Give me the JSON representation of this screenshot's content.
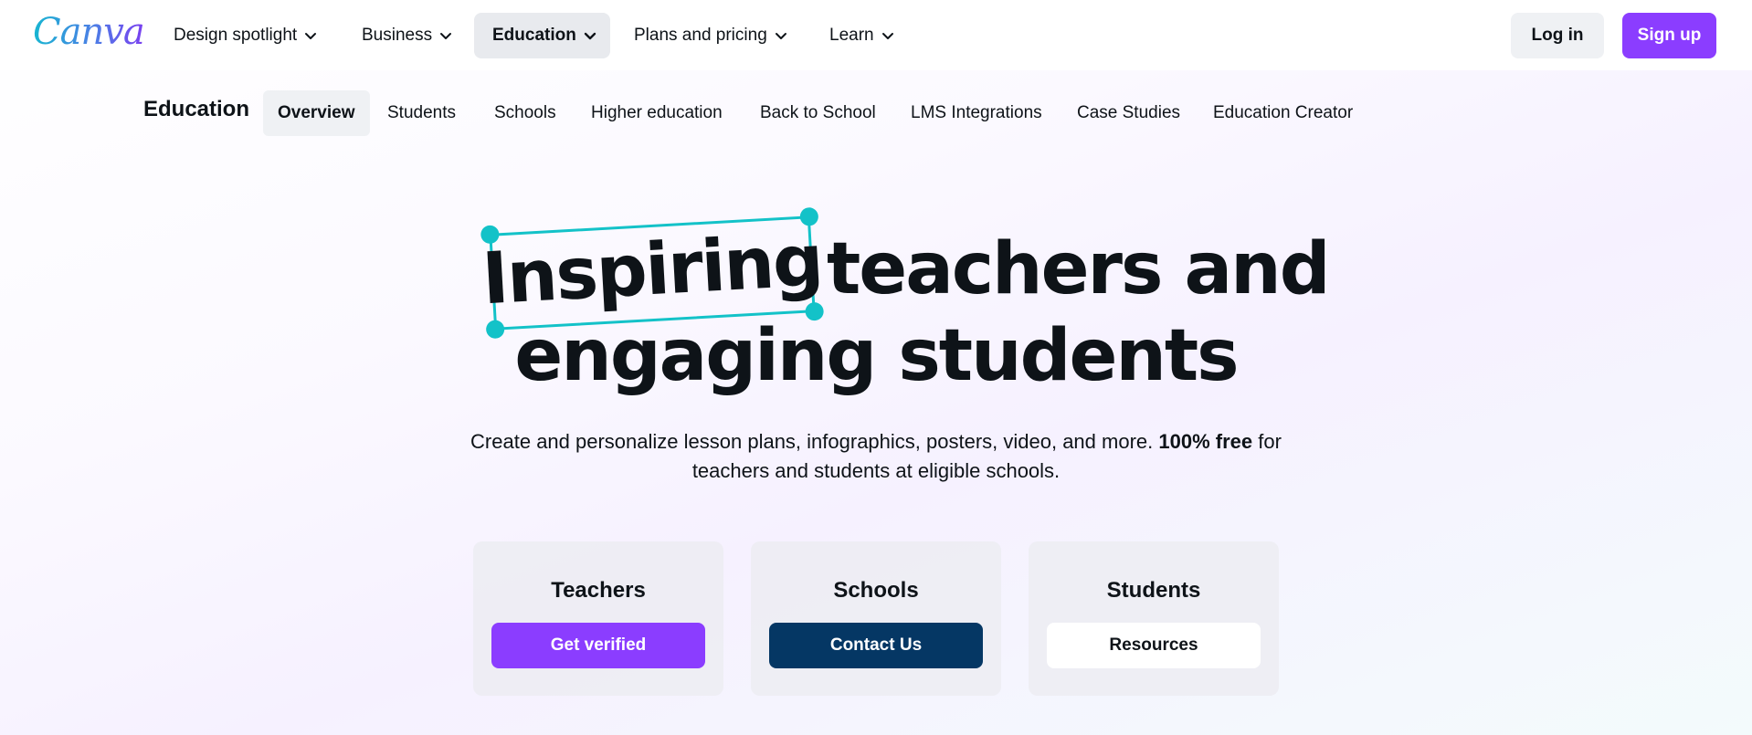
{
  "brand": {
    "logo_text": "Canva",
    "accent": "#8b3dff",
    "highlight": "#13c2c8",
    "navy": "#053764"
  },
  "topnav": {
    "items": [
      {
        "label": "Design spotlight",
        "has_dropdown": true
      },
      {
        "label": "Business",
        "has_dropdown": true
      },
      {
        "label": "Education",
        "has_dropdown": true,
        "active": true
      },
      {
        "label": "Plans and pricing",
        "has_dropdown": true
      },
      {
        "label": "Learn",
        "has_dropdown": true
      }
    ],
    "login_label": "Log in",
    "signup_label": "Sign up"
  },
  "subnav": {
    "title": "Education",
    "items": [
      {
        "label": "Overview",
        "active": true
      },
      {
        "label": "Students"
      },
      {
        "label": "Schools"
      },
      {
        "label": "Higher education"
      },
      {
        "label": "Back to School"
      },
      {
        "label": "LMS Integrations"
      },
      {
        "label": "Case Studies"
      },
      {
        "label": "Education Creator"
      }
    ]
  },
  "hero": {
    "highlight_word": "Inspiring",
    "headline_rest_line1": "teachers and",
    "headline_line2": "engaging students",
    "subtitle_pre": "Create and personalize lesson plans, infographics, posters, video, and more.",
    "subtitle_bold": "100% free",
    "subtitle_post": "for teachers and students at eligible schools."
  },
  "cards": [
    {
      "title": "Teachers",
      "button_label": "Get verified"
    },
    {
      "title": "Schools",
      "button_label": "Contact Us"
    },
    {
      "title": "Students",
      "button_label": "Resources"
    }
  ]
}
